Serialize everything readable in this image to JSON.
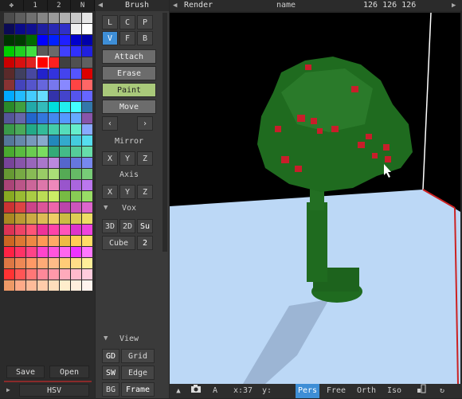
{
  "palette": {
    "tabs": [
      {
        "label": "✥"
      },
      {
        "label": "1"
      },
      {
        "label": "2"
      },
      {
        "label": "N"
      }
    ],
    "swatches": [
      "#4d4d4d",
      "#5e5e5e",
      "#707070",
      "#858585",
      "#9a9a9a",
      "#b0b0b0",
      "#c8c8c8",
      "#e6e6e6",
      "#0a0a55",
      "#0a0a88",
      "#101090",
      "#1e1ea0",
      "#2828b4",
      "#3030c8",
      "#f0f0f0",
      "#ffffff",
      "#003300",
      "#003a00",
      "#006a00",
      "#0000ff",
      "#0020ff",
      "#2020ff",
      "#0000cc",
      "#0000aa",
      "#00cc00",
      "#20d020",
      "#40e040",
      "#5a5a5a",
      "#6a6a6a",
      "#4040ff",
      "#3030ff",
      "#2020e0",
      "#cc0000",
      "#d81010",
      "#e02020",
      "#ff0000",
      "#ff2020",
      "#404040",
      "#505050",
      "#606060",
      "#5a2a2a",
      "#404060",
      "#4848a0",
      "#2222cc",
      "#3333dd",
      "#4444ee",
      "#5555ff",
      "#dd0000",
      "#883333",
      "#4444bb",
      "#5555cc",
      "#6666dd",
      "#7777ee",
      "#8888ff",
      "#ff4444",
      "#ff6666",
      "#00aaff",
      "#22bbff",
      "#44ccff",
      "#66ddff",
      "#3333aa",
      "#4444cc",
      "#5555ee",
      "#6666ff",
      "#2a8a2a",
      "#40a040",
      "#22aaaa",
      "#33bbbb",
      "#00dddd",
      "#22eeee",
      "#44ffff",
      "#3377aa",
      "#555599",
      "#6666aa",
      "#2266cc",
      "#3377dd",
      "#4488ee",
      "#5599ff",
      "#66aaff",
      "#8855aa",
      "#3a9a4a",
      "#4aaa5a",
      "#22aa88",
      "#33bb99",
      "#44ccaa",
      "#55ddbb",
      "#66eecc",
      "#88aaff",
      "#557799",
      "#6688aa",
      "#7799bb",
      "#88aacc",
      "#2288bb",
      "#33aacc",
      "#44ccdd",
      "#55ddee",
      "#4aaa30",
      "#5abb40",
      "#6acc50",
      "#7add60",
      "#33aa77",
      "#44bb88",
      "#55cc99",
      "#66ddaa",
      "#774499",
      "#8855aa",
      "#9966bb",
      "#aa77cc",
      "#bb88dd",
      "#5566cc",
      "#6677dd",
      "#7788ee",
      "#669933",
      "#77aa44",
      "#88bb55",
      "#99cc66",
      "#aadd77",
      "#55aa55",
      "#66bb66",
      "#77cc77",
      "#aa4477",
      "#bb5588",
      "#cc6699",
      "#dd77aa",
      "#ee88bb",
      "#9955cc",
      "#aa66dd",
      "#bb77ee",
      "#88aa22",
      "#99bb33",
      "#aacc44",
      "#bbdd55",
      "#ccee66",
      "#77bb44",
      "#88cc55",
      "#99dd66",
      "#cc3333",
      "#dd4444",
      "#cc4488",
      "#dd5599",
      "#ee66aa",
      "#bb44aa",
      "#cc55bb",
      "#dd66cc",
      "#aa8822",
      "#bb9933",
      "#ccaa44",
      "#ddbb55",
      "#eecc66",
      "#ccbb44",
      "#ddcc55",
      "#eedd66",
      "#dd3355",
      "#ee4466",
      "#ff5577",
      "#ee3399",
      "#ff44aa",
      "#ff55bb",
      "#dd33cc",
      "#ee44dd",
      "#cc6622",
      "#dd7733",
      "#ee8844",
      "#ff9955",
      "#ffaa66",
      "#eebb44",
      "#ffcc55",
      "#ffdd66",
      "#ff2244",
      "#ff3366",
      "#ff4488",
      "#ff44cc",
      "#ff55dd",
      "#ff66ee",
      "#ee33ff",
      "#ff77ff",
      "#dd7744",
      "#ee8855",
      "#ff9966",
      "#ffaa77",
      "#ffbb88",
      "#ffcc77",
      "#ffdd88",
      "#ffee99",
      "#ff3333",
      "#ff5555",
      "#ff7777",
      "#ff8899",
      "#ff99aa",
      "#ffaabb",
      "#ffbbcc",
      "#ffccdd",
      "#ee9966",
      "#ffaa88",
      "#ffbb99",
      "#ffccaa",
      "#ffddbb",
      "#ffeecc",
      "#ffeedd",
      "#fff4ee"
    ],
    "save_label": "Save",
    "open_label": "Open",
    "mode_label": "HSV",
    "play_icon": "play-icon"
  },
  "tools": {
    "header": {
      "collapse_icon": "chevron-left-icon",
      "title": "Brush"
    },
    "mode_buttons": [
      "L",
      "C",
      "P",
      "V",
      "F",
      "B"
    ],
    "actions": {
      "attach": "Attach",
      "erase": "Erase",
      "paint": "Paint",
      "move": "Move"
    },
    "arrows": [
      "‹",
      "›"
    ],
    "mirror_label": "Mirror",
    "mirror_axes": [
      "X",
      "Y",
      "Z"
    ],
    "axis_label": "Axis",
    "axis_axes": [
      "X",
      "Y",
      "Z"
    ],
    "vox_label": "Vox",
    "vox_dims": [
      "3D",
      "2D",
      "Su"
    ],
    "cube_label": "Cube",
    "cube_size": "2",
    "view_label": "View",
    "view_rows": [
      {
        "short": "GD",
        "label": "Grid"
      },
      {
        "short": "SW",
        "label": "Edge"
      },
      {
        "short": "BG",
        "label": "Frame"
      }
    ]
  },
  "header": {
    "render_label": "Render",
    "name_label": "name",
    "color_readout": "126 126 126"
  },
  "viewport": {
    "background": "#000000",
    "floor_color": "#bcd8f6",
    "tree_color": "#1f6b1f",
    "fruit_color": "#c81e2a"
  },
  "bottom": {
    "camera_icon": "camera-icon",
    "a_label": "A",
    "x_label": "x:37",
    "y_label": "y:",
    "modes": [
      "Pers",
      "Free",
      "Orth",
      "Iso"
    ]
  },
  "colors": {
    "accent": "#3e8ed6",
    "paint_green": "#a9c97a",
    "selected_swatch": "#ff0000"
  }
}
